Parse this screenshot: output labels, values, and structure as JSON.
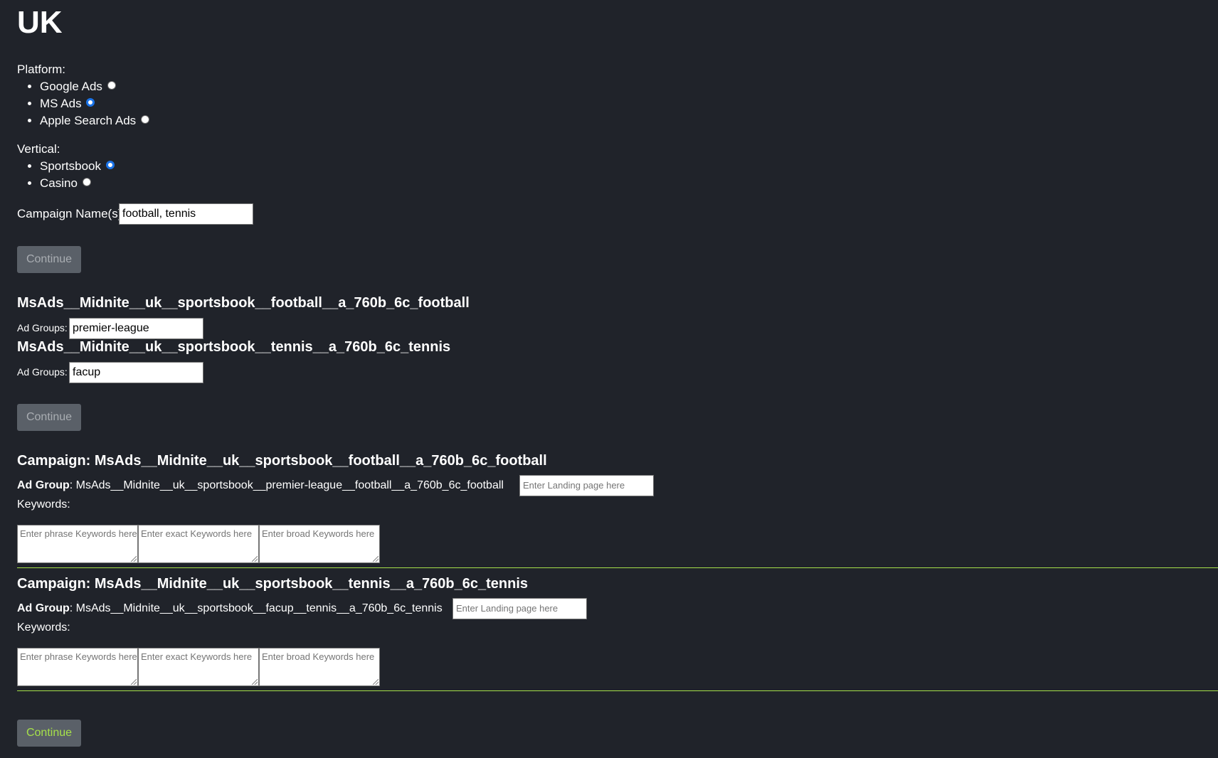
{
  "page": {
    "title": "UK"
  },
  "platform": {
    "label": "Platform:",
    "options": [
      {
        "label": "Google Ads",
        "checked": false
      },
      {
        "label": "MS Ads",
        "checked": true
      },
      {
        "label": "Apple Search Ads",
        "checked": false
      }
    ]
  },
  "vertical": {
    "label": "Vertical:",
    "options": [
      {
        "label": "Sportsbook",
        "checked": true
      },
      {
        "label": "Casino",
        "checked": false
      }
    ]
  },
  "campaign_names": {
    "label": "Campaign Name(s):",
    "value": "football, tennis"
  },
  "continue_1": {
    "label": "Continue"
  },
  "ad_group_sections": [
    {
      "title": "MsAds__Midnite__uk__sportsbook__football__a_760b_6c_football",
      "label": "Ad Groups:",
      "value": "premier-league"
    },
    {
      "title": "MsAds__Midnite__uk__sportsbook__tennis__a_760b_6c_tennis",
      "label": "Ad Groups:",
      "value": "facup"
    }
  ],
  "continue_2": {
    "label": "Continue"
  },
  "campaigns": [
    {
      "title": "Campaign: MsAds__Midnite__uk__sportsbook__football__a_760b_6c_football",
      "ad_group_label": "Ad Group",
      "ad_group_value": ": MsAds__Midnite__uk__sportsbook__premier-league__football__a_760b_6c_football",
      "landing_placeholder": "Enter Landing page here",
      "keywords_label": "Keywords:",
      "phrase_placeholder": "Enter phrase Keywords here",
      "exact_placeholder": "Enter exact Keywords here",
      "broad_placeholder": "Enter broad Keywords here"
    },
    {
      "title": "Campaign: MsAds__Midnite__uk__sportsbook__tennis__a_760b_6c_tennis",
      "ad_group_label": "Ad Group",
      "ad_group_value": ": MsAds__Midnite__uk__sportsbook__facup__tennis__a_760b_6c_tennis",
      "landing_placeholder": "Enter Landing page here",
      "keywords_label": "Keywords:",
      "phrase_placeholder": "Enter phrase Keywords here",
      "exact_placeholder": "Enter exact Keywords here",
      "broad_placeholder": "Enter broad Keywords here"
    }
  ],
  "continue_3": {
    "label": "Continue"
  },
  "colors": {
    "background": "#20232a",
    "button": "#5a6068",
    "button_text_disabled": "#a9adb2",
    "accent_green": "#a6e04a",
    "radio_checked": "#1a73e8"
  }
}
